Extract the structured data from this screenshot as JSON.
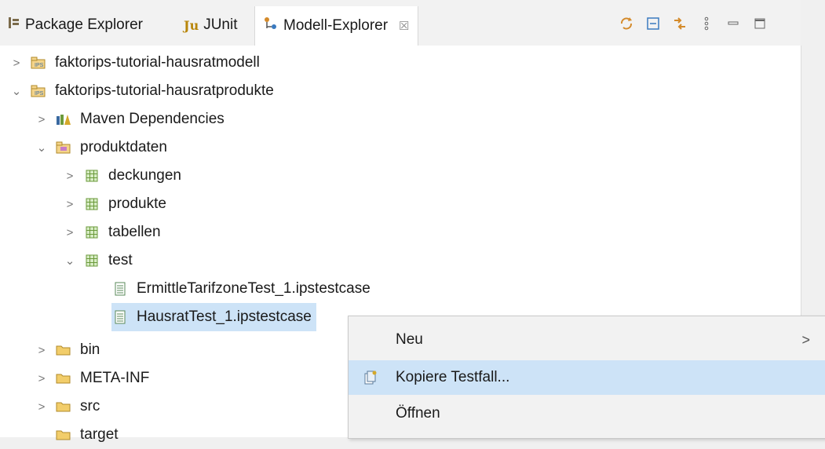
{
  "tabs": [
    {
      "label": "Package Explorer",
      "icon": "package-explorer-icon"
    },
    {
      "label": "JUnit",
      "icon": "junit-icon"
    },
    {
      "label": "Modell-Explorer",
      "icon": "model-explorer-icon",
      "close": "☒"
    }
  ],
  "toolbar": [
    "sync-icon",
    "collapse-all-icon",
    "link-editor-icon",
    "view-menu-icon",
    "minimize-icon",
    "maximize-icon"
  ],
  "tree": {
    "project1": "faktorips-tutorial-hausratmodell",
    "project2": "faktorips-tutorial-hausratprodukte",
    "maven": "Maven Dependencies",
    "produktdaten": "produktdaten",
    "deckungen": "deckungen",
    "produkte": "produkte",
    "tabellen": "tabellen",
    "test": "test",
    "file1": "ErmittleTarifzoneTest_1.ipstestcase",
    "file2": "HausratTest_1.ipstestcase",
    "bin": "bin",
    "metainf": "META-INF",
    "src": "src",
    "target": "target"
  },
  "context_menu": {
    "neu": "Neu",
    "kopiere": "Kopiere Testfall...",
    "oeffnen": "Öffnen",
    "submenu_arrow": ">"
  },
  "colors": {
    "selection": "#cde3f7",
    "package": "#6b9a3b",
    "folder": "#e0b84a"
  }
}
